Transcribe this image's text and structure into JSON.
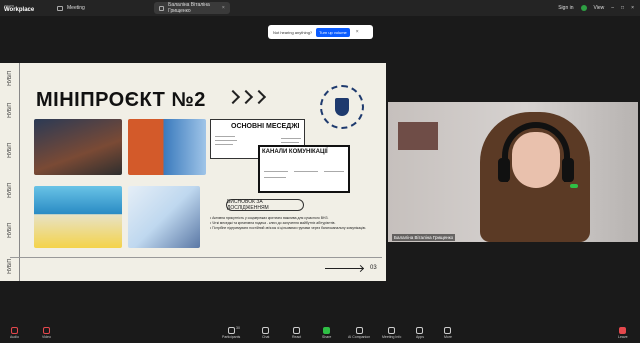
{
  "titlebar": {
    "logo_top": "zoom",
    "logo_bottom": "Workplace",
    "tab_meeting": "Meeting",
    "tab_share": "Балаліна Віталіна Грищенко",
    "signin": "Sign in",
    "view": "View"
  },
  "banner": {
    "text": "Not hearing anything?",
    "button": "Turn up volume",
    "close": "×"
  },
  "slide": {
    "stripe_text": "НУБіП",
    "title": "МІНІПРОЄКТ №2",
    "messages_head": "ОСНОВНІ МЕСЕДЖІ",
    "channels_head": "КАНАЛИ КОМУНІКАЦІЇ",
    "conclusion": "ВИСНОВОК ЗА ДОСЛІДЖЕННЯМ",
    "bullets": [
      "Активна присутність у соцмережах критично важлива для сучасного ВНЗ.",
      "Чіткі меседжі та креативна подача - ключ до залучення майбутніх абітурієнтів.",
      "Потрібне підтримувати постійний зв'язок зі цільовими групами через багатоканальну комунікацію."
    ],
    "page": "03"
  },
  "video": {
    "name": "Балаліна Віталіна Грищенко"
  },
  "toolbar": {
    "audio": "Audio",
    "video": "Video",
    "participants": "Participants",
    "participants_count": "30",
    "chat": "Chat",
    "react": "React",
    "share": "Share",
    "ai": "AI Companion",
    "meeting_info": "Meeting Info",
    "apps": "Apps",
    "more": "More",
    "leave": "Leave"
  },
  "colors": {
    "accent": "#0b5cff",
    "leave": "#e5484d",
    "share_green": "#2fbf45"
  }
}
